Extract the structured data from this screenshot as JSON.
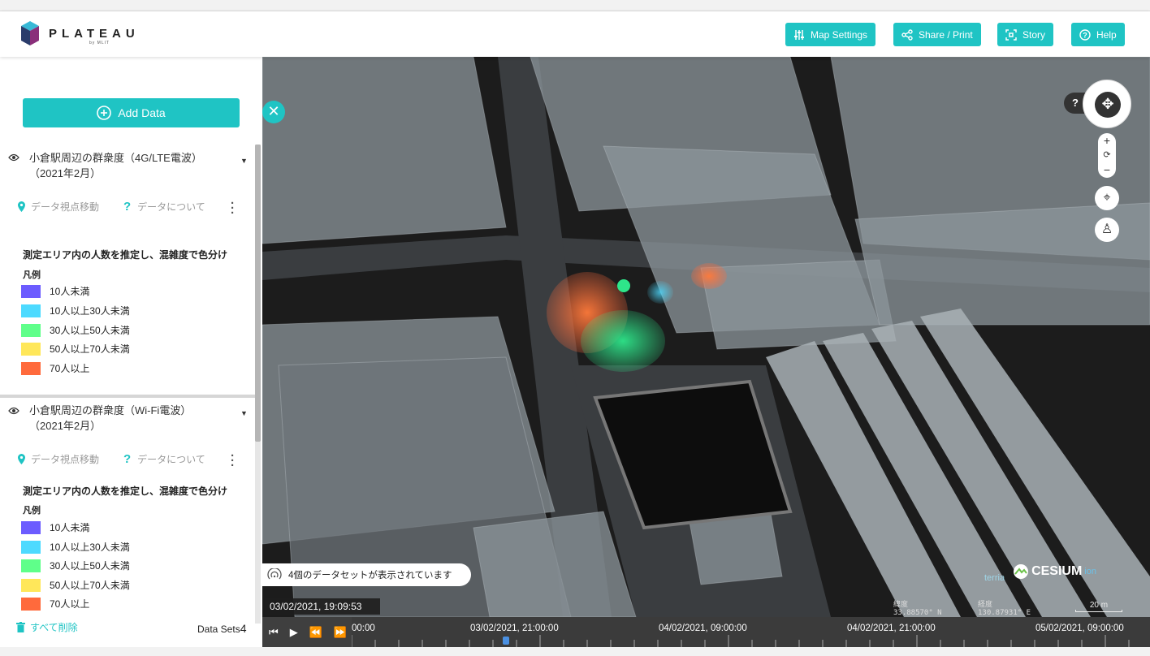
{
  "header": {
    "logo_text": "PLATEAU",
    "logo_sub": "by MLIT",
    "buttons": {
      "map_settings": "Map Settings",
      "share_print": "Share / Print",
      "story": "Story",
      "help": "Help"
    }
  },
  "sidebar": {
    "add_data_label": "Add Data",
    "datasets": [
      {
        "title_line1": "小倉駅周辺の群衆度（4G/LTE電波）",
        "title_line2": "（2021年2月）",
        "action_move": "データ視点移動",
        "action_about": "データについて",
        "description": "測定エリア内の人数を推定し、混雑度で色分け",
        "legend_title": "凡例",
        "legend": [
          {
            "label": "10人未満",
            "color": "#6c5cff"
          },
          {
            "label": "10人以上30人未満",
            "color": "#4ddaff"
          },
          {
            "label": "30人以上50人未満",
            "color": "#5fff8a"
          },
          {
            "label": "50人以上70人未満",
            "color": "#ffe75a"
          },
          {
            "label": "70人以上",
            "color": "#ff6a3c"
          }
        ]
      },
      {
        "title_line1": "小倉駅周辺の群衆度（Wi-Fi電波）",
        "title_line2": "（2021年2月）",
        "action_move": "データ視点移動",
        "action_about": "データについて",
        "description": "測定エリア内の人数を推定し、混雑度で色分け",
        "legend_title": "凡例",
        "legend": [
          {
            "label": "10人未満",
            "color": "#6c5cff"
          },
          {
            "label": "10人以上30人未満",
            "color": "#4ddaff"
          },
          {
            "label": "30人以上50人未満",
            "color": "#5fff8a"
          },
          {
            "label": "50人以上70人未満",
            "color": "#ffe75a"
          },
          {
            "label": "70人以上",
            "color": "#ff6a3c"
          }
        ]
      }
    ],
    "footer": {
      "delete_all": "すべて削除",
      "datasets_label": "Data Sets",
      "datasets_count": "4"
    }
  },
  "map": {
    "status_message": "4個のデータセットが表示されています",
    "current_datetime": "03/02/2021, 19:09:53",
    "lat_label": "緯度",
    "lat_value": "33.88570° N",
    "lon_label": "経度",
    "lon_value": "130.87931° E",
    "scale_label": "20 m",
    "credit_terria": "terria",
    "credit_cesium": "CESIUM",
    "credit_cesium_ion": "ion"
  },
  "timeline": {
    "labels": [
      "00:00",
      "03/02/2021, 21:00:00",
      "04/02/2021, 09:00:00",
      "04/02/2021, 21:00:00",
      "05/02/2021, 09:00:00"
    ]
  },
  "colors": {
    "accent": "#1fc4c4",
    "map_bg": "#222222",
    "timeline_bg": "#3f3f3f"
  }
}
